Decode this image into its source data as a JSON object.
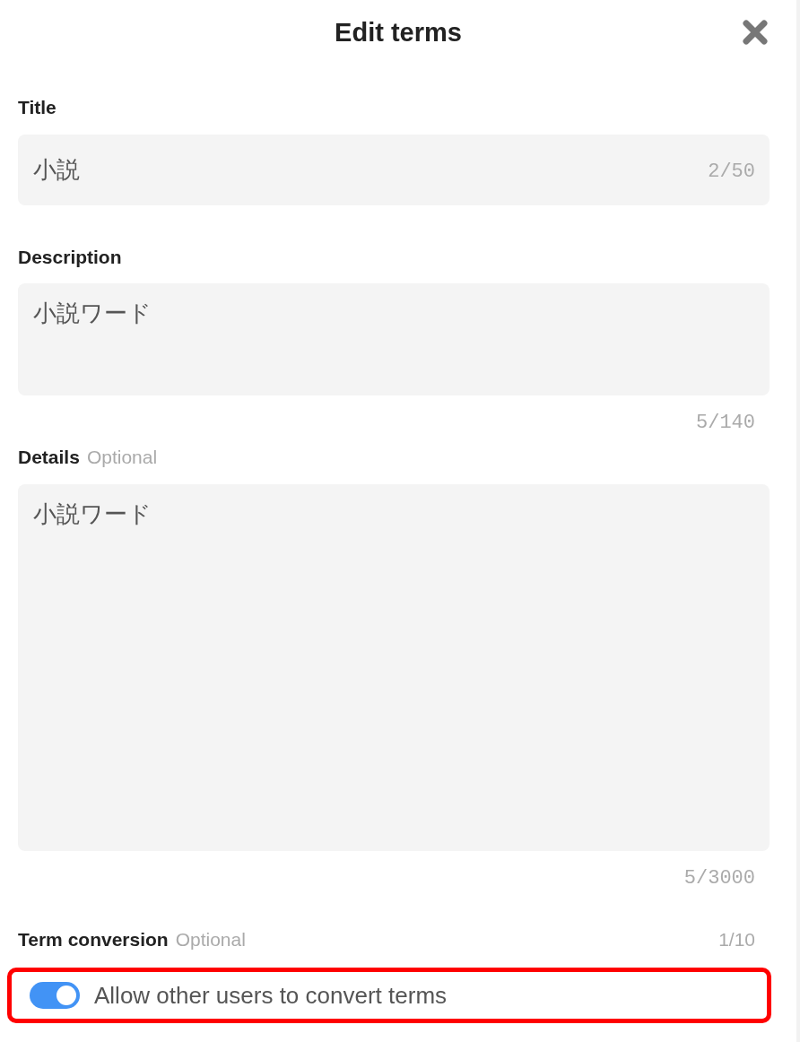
{
  "dialog": {
    "title": "Edit terms"
  },
  "fields": [
    {
      "kind": "line",
      "label": "Title",
      "value": "小説",
      "counter": "2/50"
    },
    {
      "kind": "area",
      "label": "Description",
      "value": "小説ワード",
      "counter": "5/140"
    },
    {
      "kind": "area_tall",
      "label": "Details",
      "hint": "Optional",
      "value": "小説ワード",
      "counter": "5/3000"
    }
  ],
  "term_conversion": {
    "label": "Term conversion",
    "hint": "Optional",
    "counter": "1/10",
    "toggle": {
      "label": "Allow other users to convert terms",
      "on": true,
      "highlighted": true
    }
  }
}
